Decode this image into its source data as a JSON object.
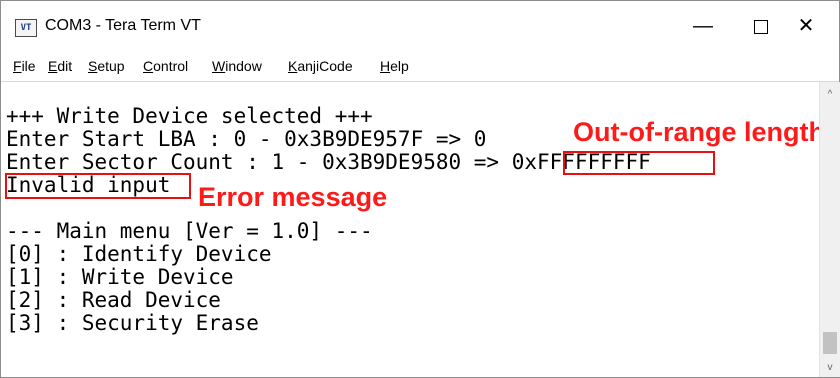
{
  "window": {
    "title": "COM3 - Tera Term VT",
    "icon_label": "VT",
    "controls": {
      "minimize": "—",
      "close": "✕"
    }
  },
  "menu": {
    "items": [
      {
        "label": "File",
        "key": "F",
        "rest": "ile"
      },
      {
        "label": "Edit",
        "key": "E",
        "rest": "dit"
      },
      {
        "label": "Setup",
        "key": "S",
        "rest": "etup"
      },
      {
        "label": "Control",
        "key": "C",
        "rest": "ontrol"
      },
      {
        "label": "Window",
        "key": "W",
        "rest": "indow"
      },
      {
        "label": "KanjiCode",
        "key": "K",
        "rest": "anjiCode"
      },
      {
        "label": "Help",
        "key": "H",
        "rest": "elp"
      }
    ]
  },
  "terminal": {
    "lines": [
      "+++ Write Device selected +++",
      "Enter Start LBA : 0 - 0x3B9DE957F => 0",
      "Enter Sector Count : 1 - 0x3B9DE9580 => 0xFFFFFFFFF",
      "Invalid input",
      "",
      "--- Main menu [Ver = 1.0] ---",
      "[0] : Identify Device",
      "[1] : Write Device",
      "[2] : Read Device",
      "[3] : Security Erase"
    ]
  },
  "annotations": {
    "length_label": "Out-of-range length",
    "error_label": "Error message",
    "color": "#ff1a1a"
  },
  "scrollbar": {
    "up": "^",
    "down": "v"
  }
}
